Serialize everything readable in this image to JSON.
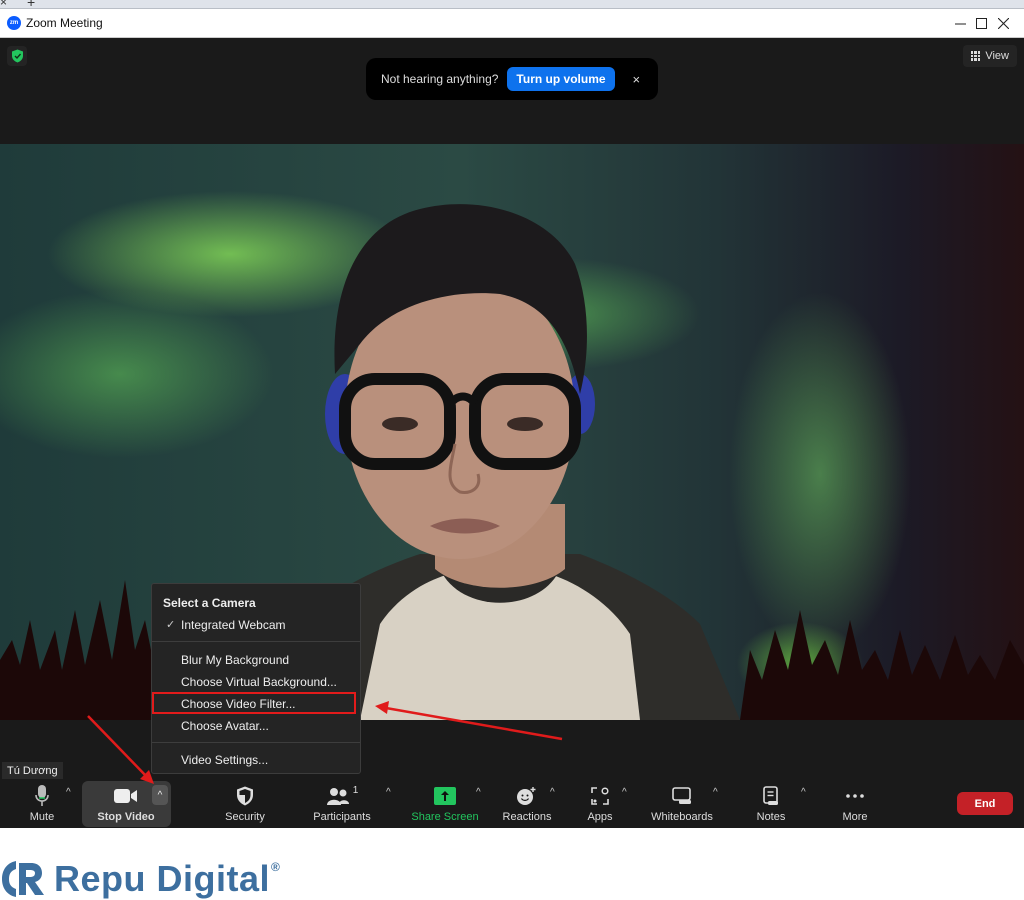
{
  "window": {
    "title": "Zoom Meeting",
    "app_icon_text": "zm",
    "controls": [
      "minimize",
      "maximize",
      "close"
    ]
  },
  "browser": {
    "new_tab_label": "+"
  },
  "top_bar": {
    "security_badge": "encrypted",
    "view_label": "View"
  },
  "notice": {
    "message": "Not hearing anything?",
    "action_label": "Turn up volume",
    "dismiss_label": "×"
  },
  "video": {
    "participant_name": "Tú Dương",
    "background": "aurora-virtual-background"
  },
  "camera_menu": {
    "header": "Select a Camera",
    "cameras": [
      {
        "label": "Integrated Webcam",
        "selected": true
      }
    ],
    "items": [
      {
        "label": "Blur My Background"
      },
      {
        "label": "Choose Virtual Background..."
      },
      {
        "label": "Choose Video Filter...",
        "highlighted": true
      },
      {
        "label": "Choose Avatar..."
      }
    ],
    "settings_label": "Video Settings..."
  },
  "toolbar": {
    "mute": "Mute",
    "stop_video": "Stop Video",
    "security": "Security",
    "participants": "Participants",
    "participants_count": "1",
    "share_screen": "Share Screen",
    "reactions": "Reactions",
    "apps": "Apps",
    "whiteboards": "Whiteboards",
    "notes": "Notes",
    "more": "More",
    "end": "End",
    "caret": "^"
  },
  "colors": {
    "accent_blue": "#0e72ed",
    "share_green": "#22c55e",
    "end_red": "#c42127",
    "highlight_red": "#e21b1b",
    "brand_blue": "#3d6f9f"
  },
  "brand": {
    "name": "Repu Digital",
    "registered": "®"
  }
}
